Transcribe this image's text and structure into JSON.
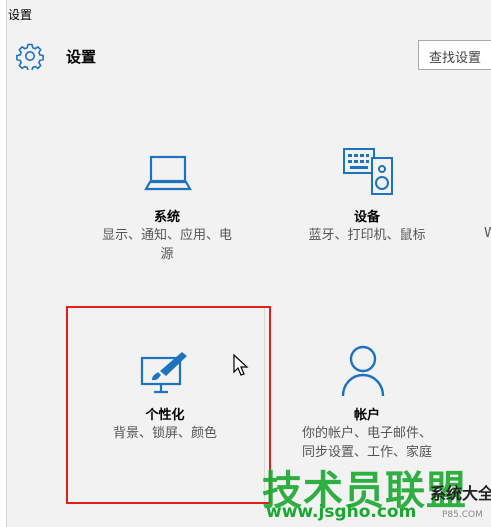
{
  "window": {
    "title": "设置"
  },
  "header": {
    "title": "设置",
    "search_placeholder": "查找设置"
  },
  "tiles": [
    {
      "name": "系统",
      "desc_line1": "显示、通知、应用、电",
      "desc_line2": "源",
      "icon": "laptop-icon"
    },
    {
      "name": "设备",
      "desc_line1": "蓝牙、打印机、鼠标",
      "icon": "devices-icon"
    },
    {
      "name": "个性化",
      "desc_line1": "背景、锁屏、颜色",
      "icon": "personalization-icon"
    },
    {
      "name": "帐户",
      "desc_line1": "你的帐户、电子邮件、",
      "desc_line2": "同步设置、工作、家庭",
      "icon": "person-icon"
    }
  ],
  "partial_right": "W",
  "watermark": {
    "main": "技术员联盟",
    "suffix": "系统大全",
    "url": "www.jsgho.com",
    "small": "P85.COM"
  },
  "colors": {
    "accent": "#1e73be",
    "highlight": "#e0201c",
    "background": "#f2f2f2"
  }
}
